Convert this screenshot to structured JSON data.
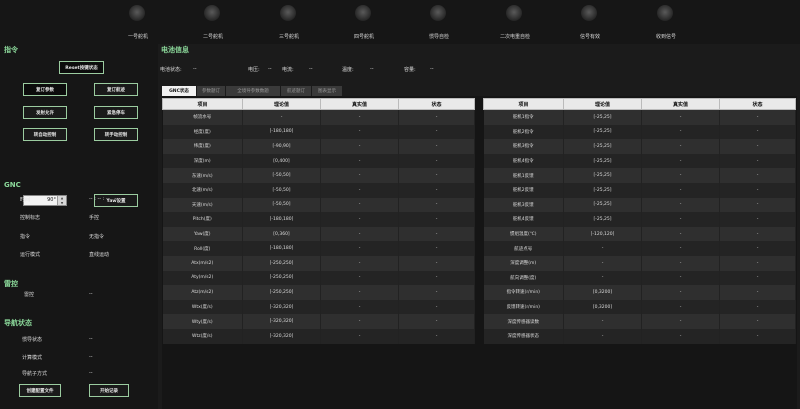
{
  "indicators": [
    "一号舵机",
    "二号舵机",
    "三号舵机",
    "四号舵机",
    "惯导自检",
    "二次电重自检",
    "信号有效",
    "收到信号"
  ],
  "left": {
    "section_command": "指令",
    "reset_label": "Reset按键状态",
    "buttons": [
      "复订参数",
      "复订航迹",
      "发射允许",
      "紧急停车",
      "转自动控制",
      "转手动控制"
    ],
    "angle_value": "90°",
    "yaw_label": "Yaw设置",
    "section_gnc": "GNC",
    "gnc": [
      {
        "key": "时间",
        "value": "-- : -- : -- . --"
      },
      {
        "key": "控制标志",
        "value": "手控"
      },
      {
        "key": "指令",
        "value": "无指令"
      },
      {
        "key": "运行模式",
        "value": "直线运动"
      }
    ],
    "section_radar": "雷控",
    "radar": {
      "key": "雷控",
      "value": "--"
    },
    "section_nav": "导航状态",
    "nav": [
      {
        "key": "惯导状态",
        "value": "--"
      },
      {
        "key": "计算模式",
        "value": "--"
      },
      {
        "key": "导航子方式",
        "value": "--"
      }
    ],
    "create_config_label": "创建配置文件",
    "start_record_label": "开始记录"
  },
  "main": {
    "title": "电池信息",
    "battery": [
      {
        "key": "电池状态:",
        "value": "--"
      },
      {
        "key": "电压:",
        "value": "--"
      },
      {
        "key": "电流:",
        "value": "--"
      },
      {
        "key": "温度:",
        "value": "--"
      },
      {
        "key": "容量:",
        "value": "--"
      }
    ],
    "tabs": [
      "GNC状态",
      "参数题订",
      "全境导参数数题",
      "航迹题订",
      "图表显示"
    ],
    "headers": [
      "项目",
      "理论值",
      "真实值",
      "状态"
    ],
    "left_rows": [
      [
        "帧流水号",
        "-",
        "-",
        "-"
      ],
      [
        "经度(度)",
        "[-180,180]",
        "-",
        "-"
      ],
      [
        "纬度(度)",
        "[-90,90]",
        "-",
        "-"
      ],
      [
        "深度(m)",
        "[0,400]",
        "-",
        "-"
      ],
      [
        "东速(m/s)",
        "[-50,50]",
        "-",
        "-"
      ],
      [
        "北速(m/s)",
        "[-50,50]",
        "-",
        "-"
      ],
      [
        "天速(m/s)",
        "[-50,50]",
        "-",
        "-"
      ],
      [
        "Pitch(度)",
        "[-180,180]",
        "-",
        "-"
      ],
      [
        "Yaw(度)",
        "[0,360]",
        "-",
        "-"
      ],
      [
        "Roll(度)",
        "[-180,180]",
        "-",
        "-"
      ],
      [
        "Atx(m/s2)",
        "[-250,250]",
        "-",
        "-"
      ],
      [
        "Aty(m/s2)",
        "[-250,250]",
        "-",
        "-"
      ],
      [
        "Atz(m/s2)",
        "[-250,250]",
        "-",
        "-"
      ],
      [
        "Wtx(度/s)",
        "[-320,320]",
        "-",
        "-"
      ],
      [
        "Wty(度/s)",
        "[-320,320]",
        "-",
        "-"
      ],
      [
        "Wtz(度/s)",
        "[-320,320]",
        "-",
        "-"
      ]
    ],
    "right_rows": [
      [
        "舵机1指令",
        "[-25,25]",
        "-",
        "-"
      ],
      [
        "舵机2指令",
        "[-25,25]",
        "-",
        "-"
      ],
      [
        "舵机3指令",
        "[-25,25]",
        "-",
        "-"
      ],
      [
        "舵机4指令",
        "[-25,25]",
        "-",
        "-"
      ],
      [
        "舵机1反馈",
        "[-25,25]",
        "-",
        "-"
      ],
      [
        "舵机2反馈",
        "[-25,25]",
        "-",
        "-"
      ],
      [
        "舵机3反馈",
        "[-25,25]",
        "-",
        "-"
      ],
      [
        "舵机4反馈",
        "[-25,25]",
        "-",
        "-"
      ],
      [
        "惯组温度(℃)",
        "[-120,120]",
        "-",
        "-"
      ],
      [
        "航迹点号",
        "-",
        "-",
        "-"
      ],
      [
        "深度调整(m)",
        "-",
        "-",
        "-"
      ],
      [
        "航向调整(度)",
        "-",
        "-",
        "-"
      ],
      [
        "指令转速(r/min)",
        "[0,3200]",
        "-",
        "-"
      ],
      [
        "反馈转速(r/min)",
        "[0,3200]",
        "-",
        "-"
      ],
      [
        "深度传感器读数",
        "-",
        "-",
        "-"
      ],
      [
        "深度传感器状态",
        "-",
        "-",
        "-"
      ]
    ]
  }
}
